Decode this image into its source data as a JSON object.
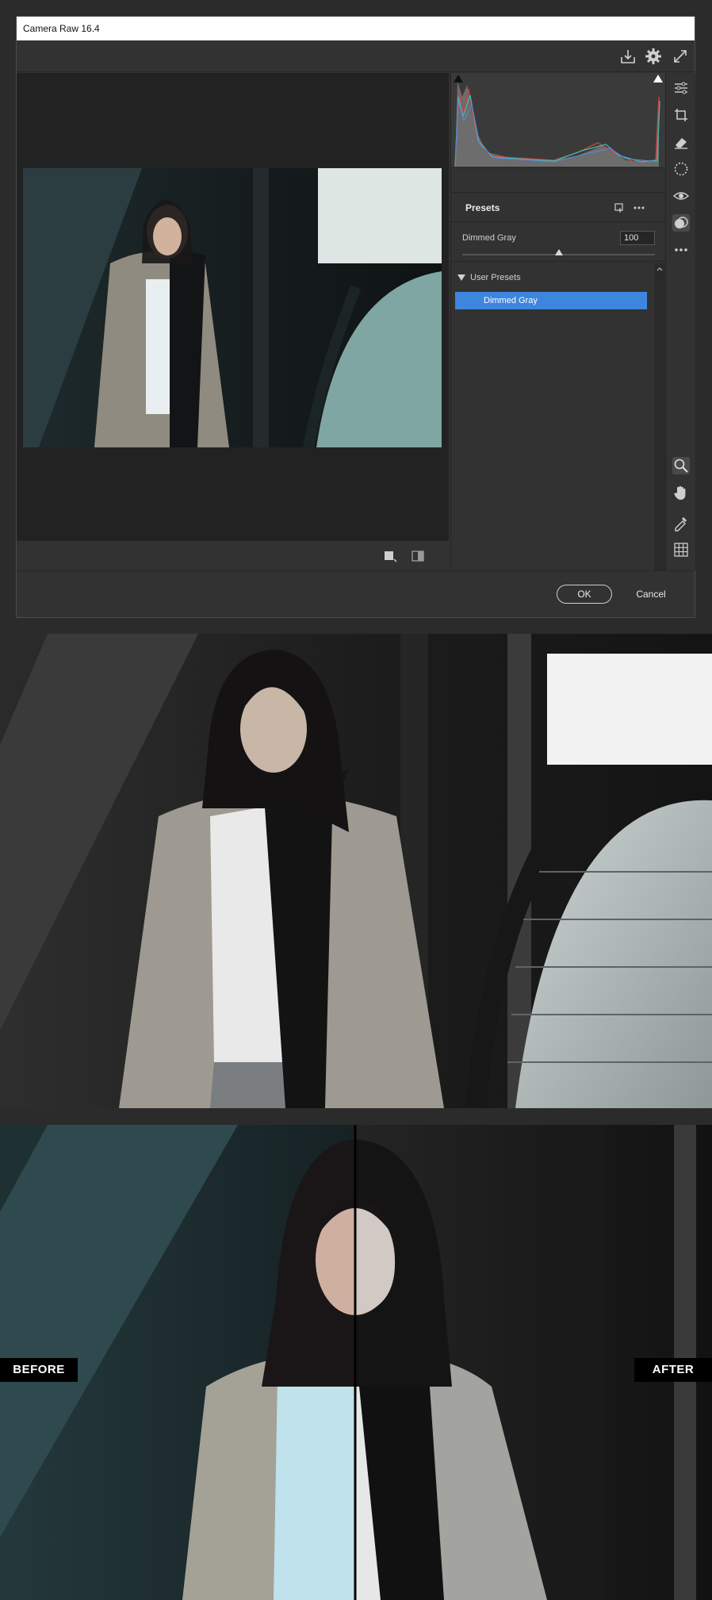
{
  "window": {
    "title": "Camera Raw 16.4"
  },
  "toolbar": {
    "icons": [
      "save-icon",
      "gear-icon",
      "fullscreen-icon"
    ]
  },
  "presets": {
    "header": "Presets",
    "current_preset": "Dimmed Gray",
    "amount_value": "100",
    "amount_fraction": 0.5,
    "group_name": "User Presets",
    "items": [
      {
        "label": "Dimmed Gray",
        "selected": true
      }
    ]
  },
  "side_tools": [
    "edit-sliders-icon",
    "crop-icon",
    "eraser-icon",
    "mask-icon",
    "redeye-icon",
    "presets-icon",
    "more-icon",
    "zoom-icon",
    "hand-icon",
    "color-sampler-icon",
    "grid-icon"
  ],
  "footer": {
    "ok_label": "OK",
    "cancel_label": "Cancel"
  },
  "comparison": {
    "before_label": "BEFORE",
    "after_label": "AFTER"
  },
  "colors": {
    "accent": "#3d86e0",
    "panel": "#323232"
  }
}
